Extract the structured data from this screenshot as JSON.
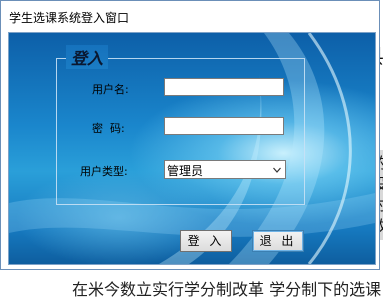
{
  "window": {
    "title": "学生选课系统登入窗口"
  },
  "background_text": {
    "right_glyph": "县",
    "right_lines": [
      "的",
      "投",
      "时",
      "改"
    ],
    "bottom_line": "在米今数立实行学分制改革 学分制下的选课"
  },
  "login": {
    "group_title": "登入",
    "username_label": "用户名:",
    "username_value": "",
    "password_label": "密  码:",
    "password_value": "",
    "user_type_label": "用户类型:",
    "user_type_selected": "管理员",
    "login_button": "登 入",
    "exit_button": "退 出"
  }
}
